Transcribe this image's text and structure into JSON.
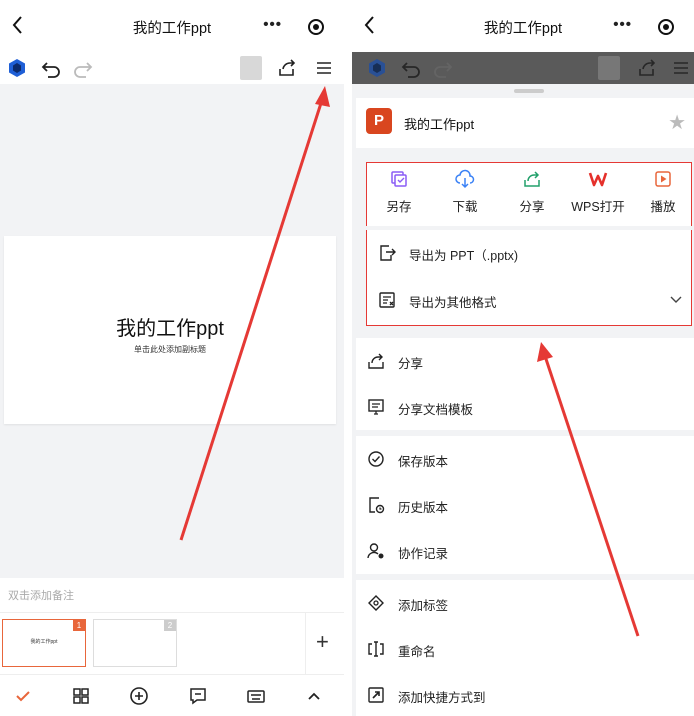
{
  "left": {
    "title": "我的工作ppt",
    "more_icon": "•••",
    "slide": {
      "title": "我的工作ppt",
      "subtitle": "单击此处添加副标题"
    },
    "notes_placeholder": "双击添加备注",
    "thumbnails": [
      {
        "number": "1",
        "title": "我的工作ppt",
        "active": true
      },
      {
        "number": "2",
        "title": "",
        "active": false
      }
    ],
    "add_slide_icon": "+",
    "bottom_icons": [
      "check-icon",
      "grid-icon",
      "add-circle-icon",
      "comment-icon",
      "keyboard-icon",
      "chevron-up-icon"
    ]
  },
  "right": {
    "title": "我的工作ppt",
    "more_icon": "•••",
    "file_name": "我的工作ppt",
    "file_badge": "P",
    "quick_actions": [
      {
        "label": "另存",
        "icon": "save-as-icon",
        "color": "#8a5cf5"
      },
      {
        "label": "下载",
        "icon": "download-cloud-icon",
        "color": "#3b82f6"
      },
      {
        "label": "分享",
        "icon": "share-icon",
        "color": "#22a06b"
      },
      {
        "label": "WPS打开",
        "icon": "wps-icon",
        "color": "#e5302b"
      },
      {
        "label": "播放",
        "icon": "play-icon",
        "color": "#e8663b"
      }
    ],
    "export_items": [
      {
        "label": "导出为 PPT（.pptx)",
        "icon": "export-icon"
      },
      {
        "label": "导出为其他格式",
        "icon": "export-format-icon"
      }
    ],
    "share_group": [
      {
        "label": "分享",
        "icon": "share-icon"
      },
      {
        "label": "分享文档模板",
        "icon": "template-icon"
      }
    ],
    "version_group": [
      {
        "label": "保存版本",
        "icon": "check-circle-icon"
      },
      {
        "label": "历史版本",
        "icon": "history-icon"
      },
      {
        "label": "协作记录",
        "icon": "collab-icon"
      }
    ],
    "other_group": [
      {
        "label": "添加标签",
        "icon": "tag-icon"
      },
      {
        "label": "重命名",
        "icon": "rename-icon"
      },
      {
        "label": "添加快捷方式到",
        "icon": "shortcut-icon"
      }
    ]
  },
  "colors": {
    "accent_red": "#e53935",
    "ppt_orange": "#d9461f",
    "slide_highlight": "#e8663b"
  }
}
